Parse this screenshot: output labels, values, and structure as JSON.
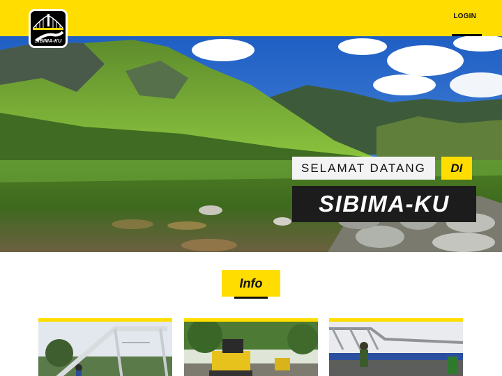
{
  "header": {
    "logo_text": "SIBIMA-KU",
    "login_label": "LOGIN"
  },
  "hero": {
    "welcome_text": "SELAMAT DATANG",
    "welcome_di": "DI",
    "brand_text": "SIBIMA-KU",
    "slide_count": 3,
    "active_slide": 1
  },
  "info": {
    "title": "Info"
  },
  "cards": [
    {
      "icon": "bridge-photo"
    },
    {
      "icon": "road-construction-photo"
    },
    {
      "icon": "steel-bridge-photo"
    }
  ],
  "colors": {
    "accent": "#ffdd00",
    "dark": "#1c1c1c"
  }
}
